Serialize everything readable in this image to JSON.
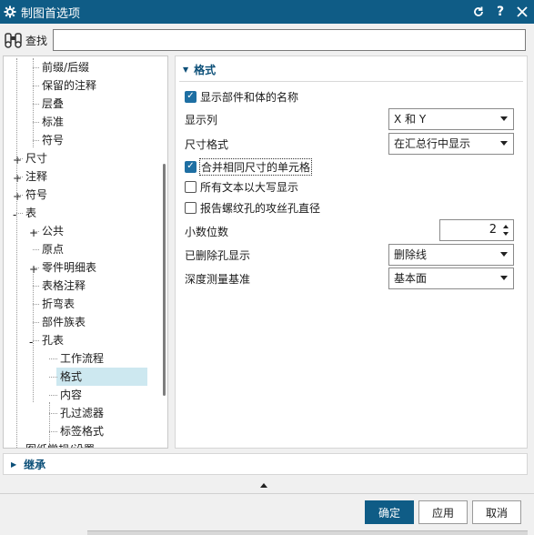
{
  "window": {
    "title": "制图首选项",
    "icon": "gear-icon",
    "buttons": [
      "reset-icon",
      "help-icon",
      "close-icon"
    ]
  },
  "search": {
    "label": "查找",
    "value": "",
    "placeholder": ""
  },
  "tree": {
    "items": [
      {
        "label": "前缀/后缀",
        "level": 2,
        "expander": ""
      },
      {
        "label": "保留的注释",
        "level": 2,
        "expander": ""
      },
      {
        "label": "层叠",
        "level": 2,
        "expander": ""
      },
      {
        "label": "标准",
        "level": 2,
        "expander": ""
      },
      {
        "label": "符号",
        "level": 2,
        "expander": ""
      },
      {
        "label": "尺寸",
        "level": 1,
        "expander": "+"
      },
      {
        "label": "注释",
        "level": 1,
        "expander": "+"
      },
      {
        "label": "符号",
        "level": 1,
        "expander": "+"
      },
      {
        "label": "表",
        "level": 1,
        "expander": "-"
      },
      {
        "label": "公共",
        "level": 2,
        "expander": "+"
      },
      {
        "label": "原点",
        "level": 2,
        "expander": ""
      },
      {
        "label": "零件明细表",
        "level": 2,
        "expander": "+"
      },
      {
        "label": "表格注释",
        "level": 2,
        "expander": ""
      },
      {
        "label": "折弯表",
        "level": 2,
        "expander": ""
      },
      {
        "label": "部件族表",
        "level": 2,
        "expander": ""
      },
      {
        "label": "孔表",
        "level": 2,
        "expander": "-"
      },
      {
        "label": "工作流程",
        "level": 3,
        "expander": ""
      },
      {
        "label": "格式",
        "level": 3,
        "expander": "",
        "selected": true
      },
      {
        "label": "内容",
        "level": 3,
        "expander": ""
      },
      {
        "label": "孔过滤器",
        "level": 3,
        "expander": ""
      },
      {
        "label": "标签格式",
        "level": 3,
        "expander": ""
      },
      {
        "label": "图纸常规/设置",
        "level": 1,
        "expander": "+"
      }
    ]
  },
  "panel": {
    "section_title": "格式",
    "show_part_body_name": {
      "label": "显示部件和体的名称",
      "checked": true
    },
    "display_column": {
      "label": "显示列",
      "value": "X 和 Y"
    },
    "dimension_format": {
      "label": "尺寸格式",
      "value": "在汇总行中显示"
    },
    "merge_cells": {
      "label": "合并相同尺寸的单元格",
      "checked": true
    },
    "uppercase_text": {
      "label": "所有文本以大写显示",
      "checked": false
    },
    "report_tap_drill": {
      "label": "报告螺纹孔的攻丝孔直径",
      "checked": false
    },
    "decimal_places": {
      "label": "小数位数",
      "value": "2"
    },
    "deleted_hole_display": {
      "label": "已删除孔显示",
      "value": "删除线"
    },
    "depth_reference": {
      "label": "深度测量基准",
      "value": "基本面"
    }
  },
  "inherit": {
    "label": "继承"
  },
  "buttons": {
    "ok": "确定",
    "apply": "应用",
    "cancel": "取消"
  },
  "colors": {
    "title_bar": "#0f5c86",
    "accent": "#1e6fa3",
    "selection": "#cde8f0"
  }
}
